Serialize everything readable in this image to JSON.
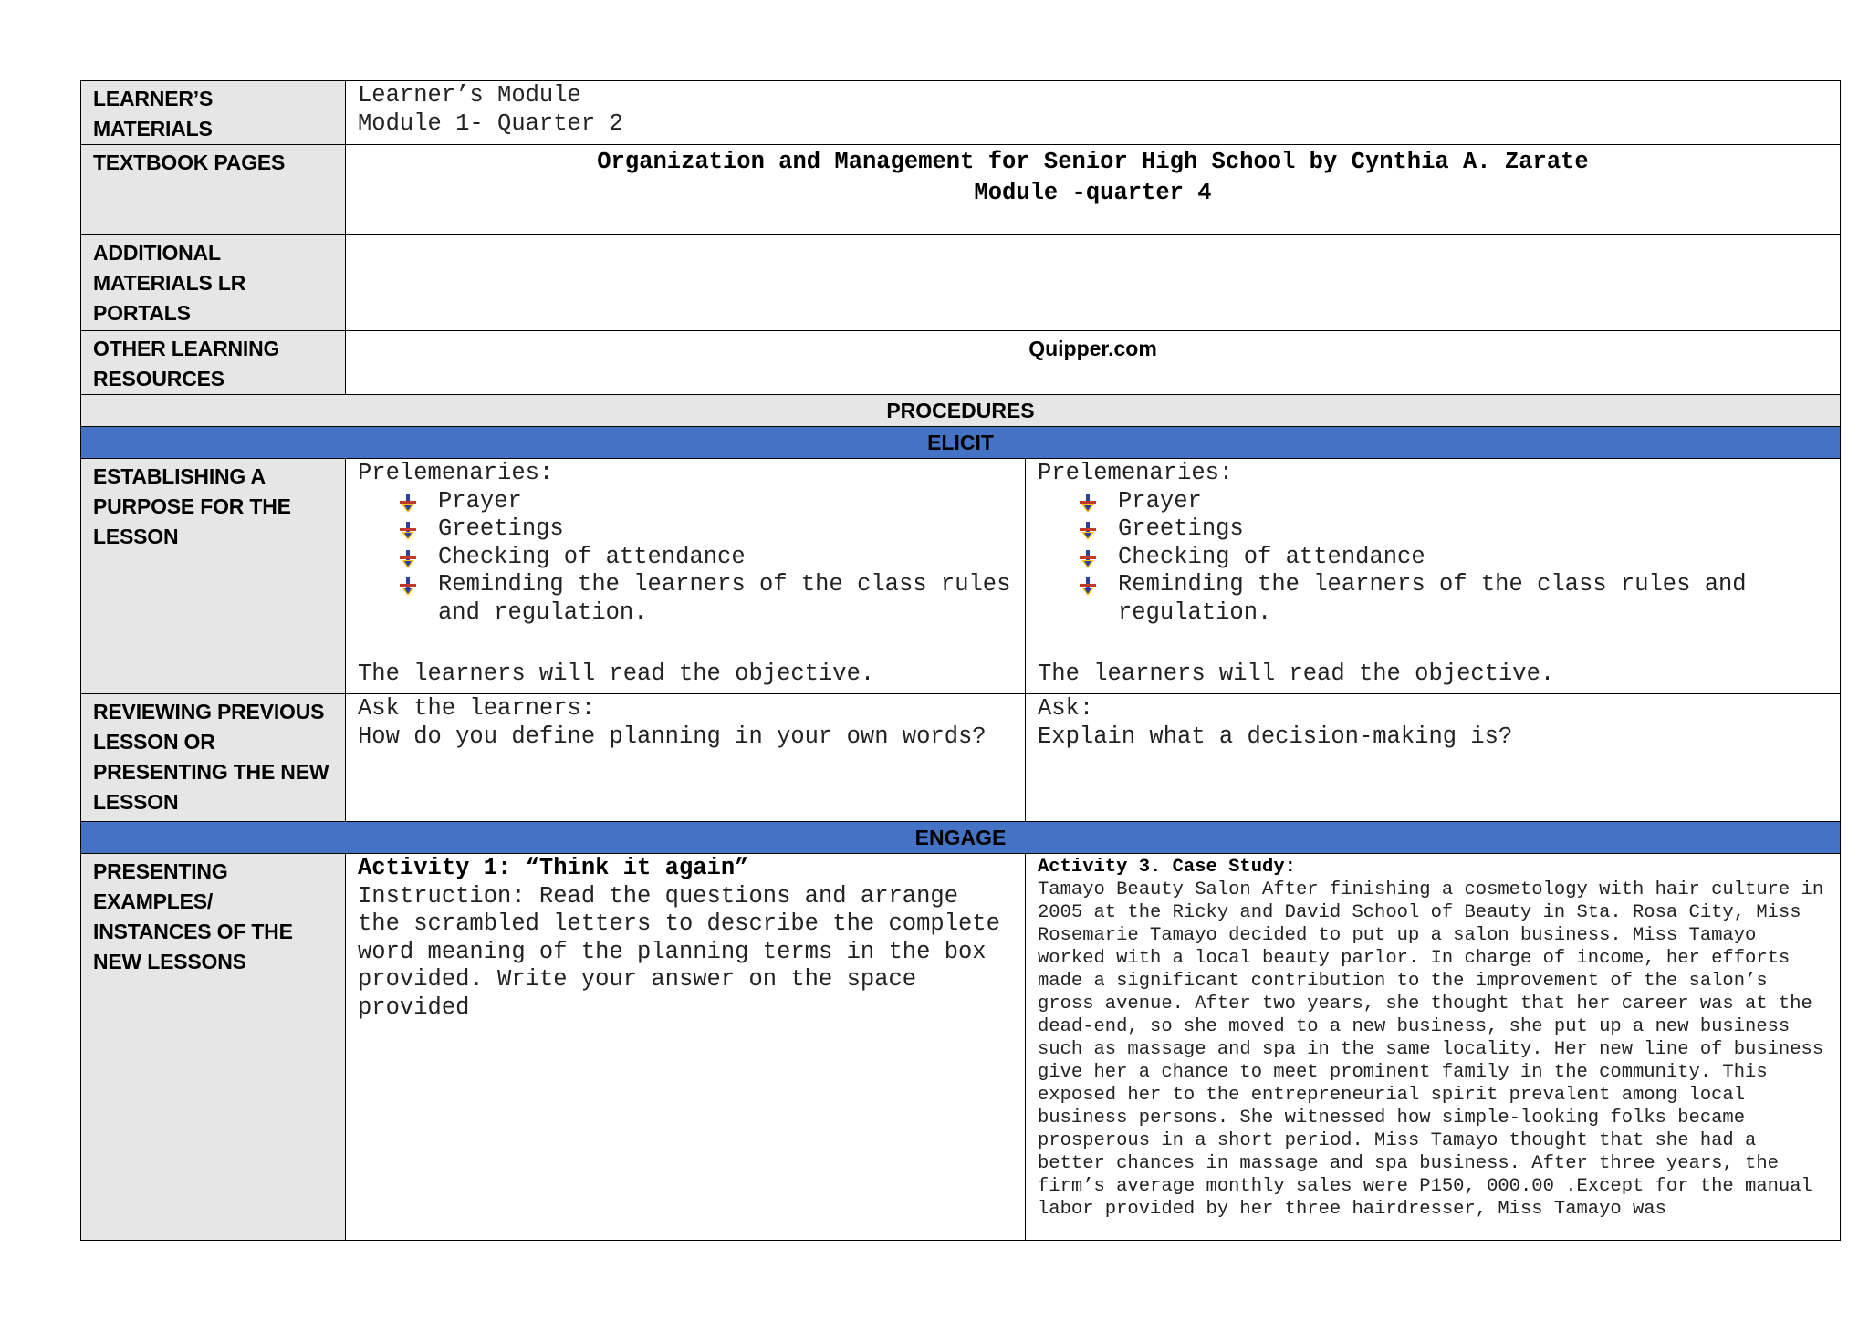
{
  "materials": {
    "learners_materials": {
      "label": "LEARNER’S MATERIALS",
      "line1": "Learner’s Module",
      "line2": "Module 1- Quarter 2"
    },
    "textbook_pages": {
      "label": "TEXTBOOK PAGES",
      "line1": "Organization and Management for Senior High School by Cynthia A. Zarate",
      "line2": "Module -quarter 4"
    },
    "additional_materials": {
      "label": "ADDITIONAL MATERIALS LR PORTALS",
      "value": ""
    },
    "other_resources": {
      "label": "OTHER LEARNING RESOURCES",
      "value": "Quipper.com"
    }
  },
  "procedures": {
    "header": "PROCEDURES",
    "elicit": "ELICIT",
    "engage": "ENGAGE"
  },
  "establishing": {
    "label": "ESTABLISHING A PURPOSE FOR THE LESSON",
    "left": {
      "title": "Prelemenaries:",
      "items": [
        "Prayer",
        "Greetings",
        "Checking of attendance",
        "Reminding the learners of the class rules and regulation."
      ],
      "closing": "The learners will read the objective."
    },
    "right": {
      "title": "Prelemenaries:",
      "items": [
        "Prayer",
        "Greetings",
        "Checking of attendance",
        "Reminding the learners of the class rules and regulation."
      ],
      "closing": "The learners will read the objective."
    }
  },
  "reviewing": {
    "label": "REVIEWING PREVIOUS LESSON OR PRESENTING THE NEW LESSON",
    "left": {
      "line1": "Ask the learners:",
      "line2": "How do you define planning in your own words?"
    },
    "right": {
      "line1": "Ask:",
      "line2": "Explain what a decision-making is?"
    }
  },
  "presenting": {
    "label": "PRESENTING EXAMPLES/ INSTANCES OF THE NEW LESSONS",
    "left": {
      "title": "Activity 1: “Think it again”",
      "instruction": "Instruction: Read the questions and arrange the scrambled letters to describe the complete word meaning of the planning terms in the box provided. Write your answer on the space provided"
    },
    "right": {
      "title": "Activity 3. Case Study:",
      "text": "Tamayo Beauty Salon After finishing a cosmetology with hair culture in 2005 at the Ricky and David School of Beauty in Sta. Rosa City, Miss Rosemarie Tamayo decided to put up a salon business. Miss Tamayo worked with a local beauty parlor. In charge of income, her efforts made a significant contribution to the improvement of the salon’s gross avenue. After two years, she thought that her career was at the dead-end, so she moved to a new business, she put up a new business such as massage and spa in the same locality. Her new line of business give her a chance to meet prominent family in the community. This exposed her to the entrepreneurial spirit prevalent among local business persons. She witnessed how simple-looking folks became prosperous in a short period. Miss Tamayo thought that she had a better chances in massage and spa business. After three years, the firm’s average monthly sales were P150, 000.00 .Except for the manual labor provided by her three hairdresser, Miss Tamayo was"
    }
  },
  "colors": {
    "band_blue": "#4472c4",
    "label_grey": "#e6e6e6",
    "bullet_red": "#c0392b",
    "bullet_yellow": "#f5c518",
    "bullet_blue": "#2f3fa0"
  },
  "icons": {
    "bullet": "arrow-down-bullet-icon"
  }
}
